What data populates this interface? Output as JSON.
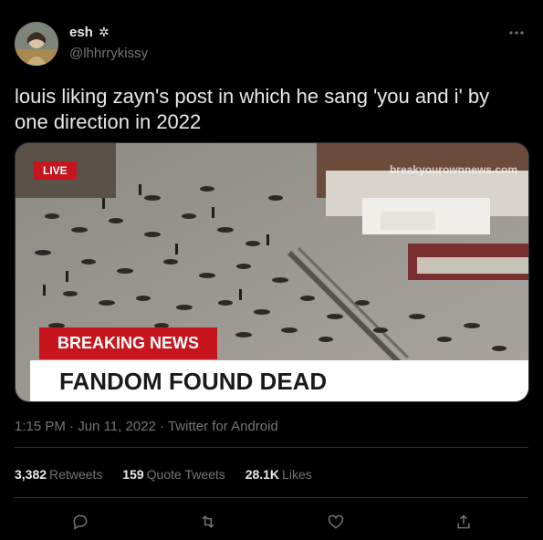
{
  "user": {
    "name": "esh",
    "name_badge": "✲",
    "handle": "@lhhrrykissy"
  },
  "more_icon": "more-horizontal-icon",
  "tweet_text": "louis liking zayn's post in which he sang 'you and i' by one direction in 2022",
  "media": {
    "live_label": "LIVE",
    "watermark": "breakyourownnews.com",
    "breaking_label": "BREAKING NEWS",
    "headline": "FANDOM FOUND DEAD"
  },
  "meta": {
    "time": "1:15 PM",
    "date": "Jun 11, 2022",
    "source": "Twitter for Android",
    "separator": "·"
  },
  "stats": {
    "retweets_count": "3,382",
    "retweets_label": "Retweets",
    "quotes_count": "159",
    "quotes_label": "Quote Tweets",
    "likes_count": "28.1K",
    "likes_label": "Likes"
  },
  "actions": [
    "reply-icon",
    "retweet-icon",
    "like-icon",
    "share-icon"
  ],
  "colors": {
    "background": "#000000",
    "text": "#e7e9ea",
    "muted": "#71767b",
    "divider": "#2f3336",
    "breaking_red": "#c8141c"
  }
}
